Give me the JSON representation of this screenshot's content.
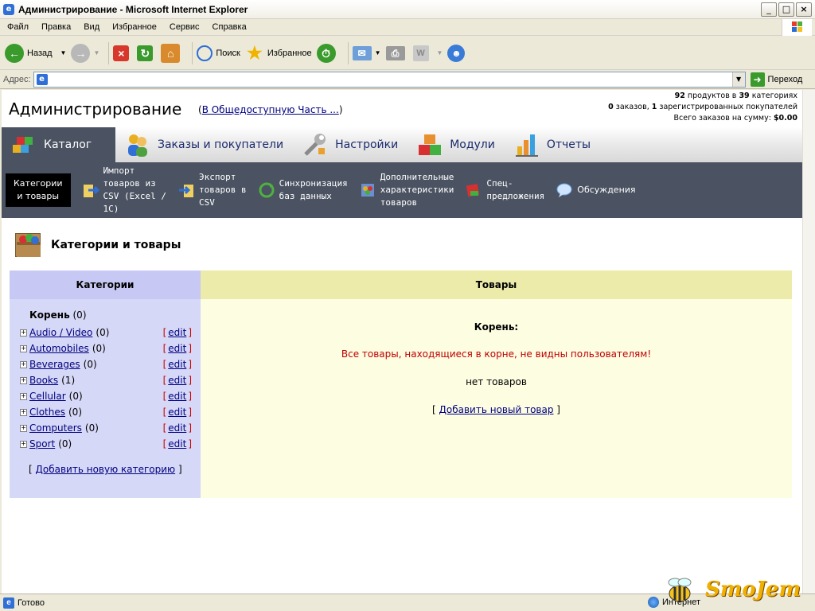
{
  "window": {
    "title": "Администрирование - Microsoft Internet Explorer",
    "min": "_",
    "max": "□",
    "close": "×"
  },
  "menu": [
    "Файл",
    "Правка",
    "Вид",
    "Избранное",
    "Сервис",
    "Справка"
  ],
  "toolbar": {
    "back": "Назад",
    "search": "Поиск",
    "favorites": "Избранное"
  },
  "address": {
    "label": "Адрес:",
    "value": "",
    "go": "Переход"
  },
  "header": {
    "title": "Администрирование",
    "public_link": "В Общедоступную Часть ...",
    "stats": {
      "products": "92",
      "products_text": "продуктов в",
      "categories": "39",
      "categories_text": "категориях",
      "orders": "0",
      "orders_text": "заказов,",
      "customers": "1",
      "customers_text": "зарегистрированных покупателей",
      "total_text": "Всего заказов на сумму:",
      "total": "$0.00"
    }
  },
  "main_tabs": [
    {
      "label": "Каталог",
      "active": true
    },
    {
      "label": "Заказы и покупатели"
    },
    {
      "label": "Настройки"
    },
    {
      "label": "Модули"
    },
    {
      "label": "Отчеты"
    }
  ],
  "sub_tabs": [
    {
      "label": "Категории\nи товары",
      "active": true
    },
    {
      "label": "Импорт\nтоваров из\nCSV (Excel /\n1C)"
    },
    {
      "label": "Экспорт\nтоваров в\nCSV"
    },
    {
      "label": "Синхронизация\nбаз данных"
    },
    {
      "label": "Дополнительные\nхарактеристики\nтоваров"
    },
    {
      "label": "Спец-\nпредложения"
    },
    {
      "label": "Обсуждения"
    }
  ],
  "page_title": "Категории и товары",
  "categories": {
    "heading": "Категории",
    "root_label": "Корень",
    "root_count": "(0)",
    "items": [
      {
        "name": "Audio / Video",
        "count": "(0)"
      },
      {
        "name": "Automobiles",
        "count": "(0)"
      },
      {
        "name": "Beverages",
        "count": "(0)"
      },
      {
        "name": "Books",
        "count": "(1)"
      },
      {
        "name": "Cellular",
        "count": "(0)"
      },
      {
        "name": "Clothes",
        "count": "(0)"
      },
      {
        "name": "Computers",
        "count": "(0)"
      },
      {
        "name": "Sport",
        "count": "(0)"
      }
    ],
    "edit_label": "edit",
    "add_label": "Добавить новую категорию"
  },
  "products": {
    "heading": "Товары",
    "root": "Корень:",
    "warning": "Все товары, находящиеся в корне, не видны пользователям!",
    "empty": "нет товаров",
    "add_label": "Добавить новый товар"
  },
  "statusbar": {
    "text": "Готово",
    "zone": "Интернет"
  },
  "watermark": "SmoJem"
}
